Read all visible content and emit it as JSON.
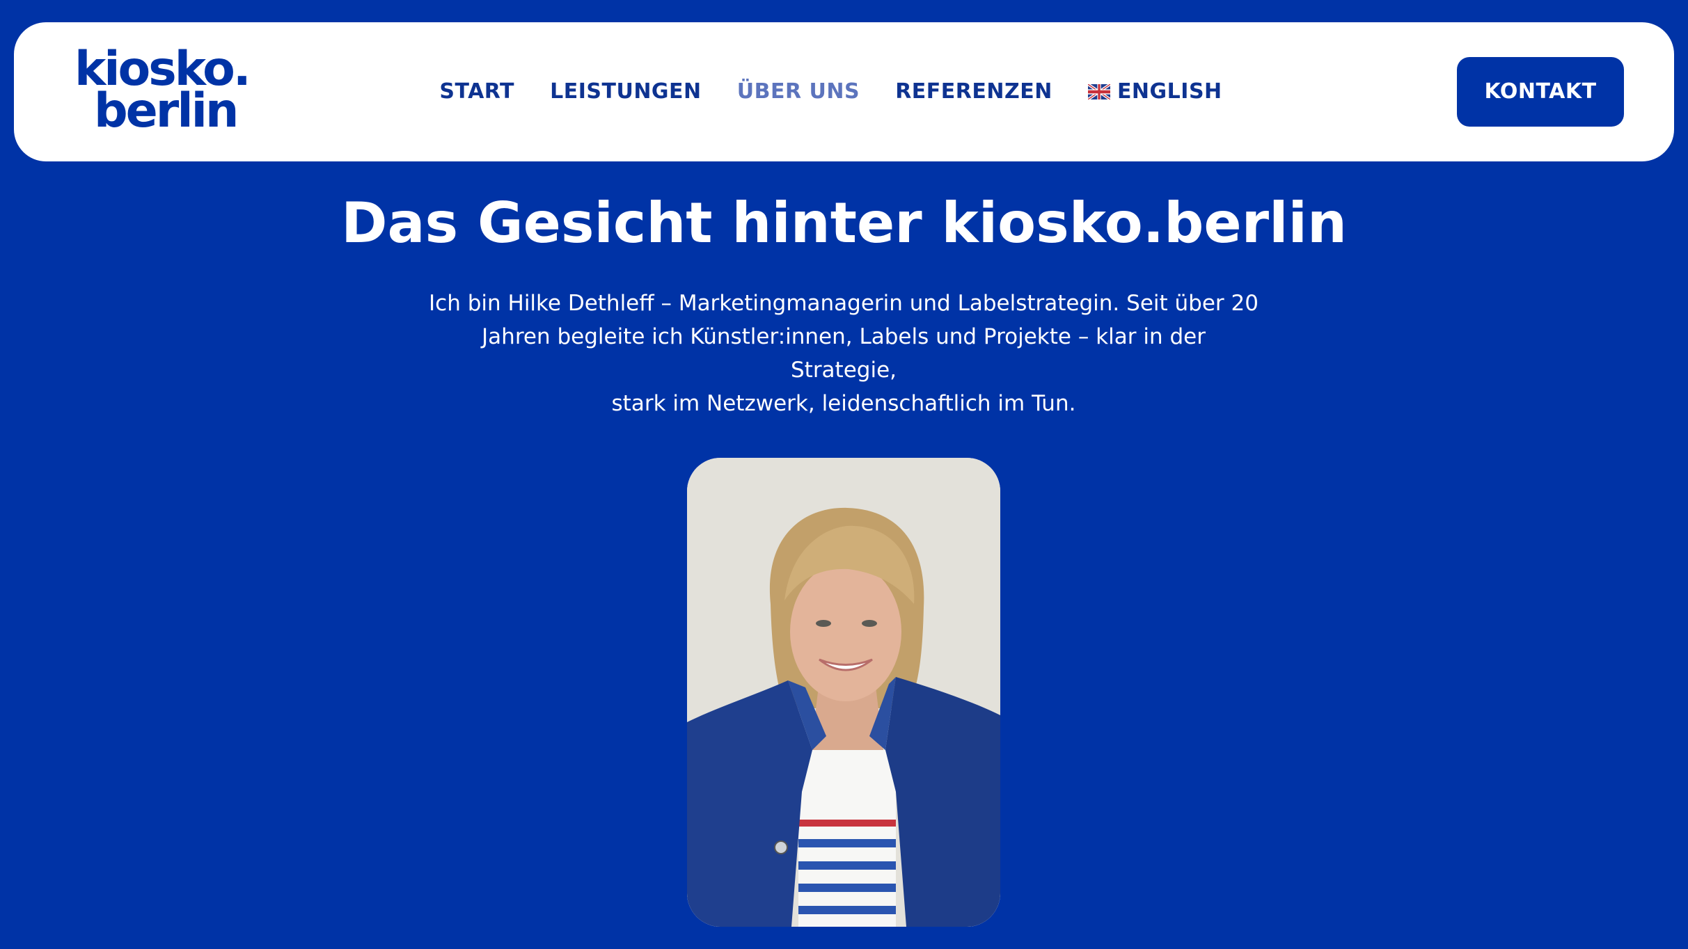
{
  "brand": {
    "logo_line1": "kiosko.",
    "logo_line2": "berlin"
  },
  "nav": {
    "items": [
      {
        "label": "START",
        "active": false
      },
      {
        "label": "LEISTUNGEN",
        "active": false
      },
      {
        "label": "ÜBER UNS",
        "active": true
      },
      {
        "label": "REFERENZEN",
        "active": false
      }
    ],
    "language": {
      "label": "ENGLISH",
      "icon": "uk-flag-icon"
    },
    "cta_label": "KONTAKT"
  },
  "hero": {
    "title": "Das Gesicht hinter kiosko.berlin",
    "intro_lines": [
      "Ich bin Hilke Dethleff – Marketingmanagerin und Labelstrategin. Seit über 20",
      "Jahren begleite ich Künstler:innen, Labels und Projekte – klar in der Strategie,",
      "stark im Netzwerk, leidenschaftlich im Tun."
    ]
  },
  "colors": {
    "brand_blue": "#0033a6",
    "nav_text": "#0e3391",
    "nav_active": "#5c74bd",
    "white": "#ffffff"
  }
}
